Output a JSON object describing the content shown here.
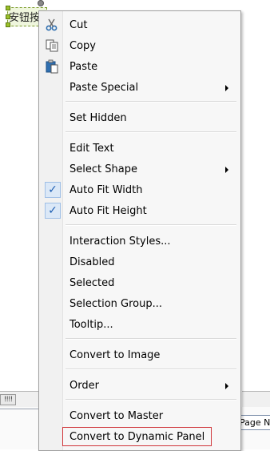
{
  "canvas": {
    "widget_text": "安钮按"
  },
  "menu": {
    "cut": "Cut",
    "copy": "Copy",
    "paste": "Paste",
    "paste_special": "Paste Special",
    "set_hidden": "Set Hidden",
    "edit_text": "Edit Text",
    "select_shape": "Select Shape",
    "auto_fit_width": "Auto Fit Width",
    "auto_fit_height": "Auto Fit Height",
    "interaction_styles": "Interaction Styles...",
    "disabled": "Disabled",
    "selected": "Selected",
    "selection_group": "Selection Group...",
    "tooltip": "Tooltip...",
    "convert_to_image": "Convert to Image",
    "order": "Order",
    "convert_to_master": "Convert to Master",
    "convert_to_dynamic_panel": "Convert to Dynamic Panel"
  },
  "checked": {
    "auto_fit_width": true,
    "auto_fit_height": true
  },
  "bottom": {
    "page_notes_tab": "Page Notes",
    "scroll_grip": "!!!!"
  }
}
